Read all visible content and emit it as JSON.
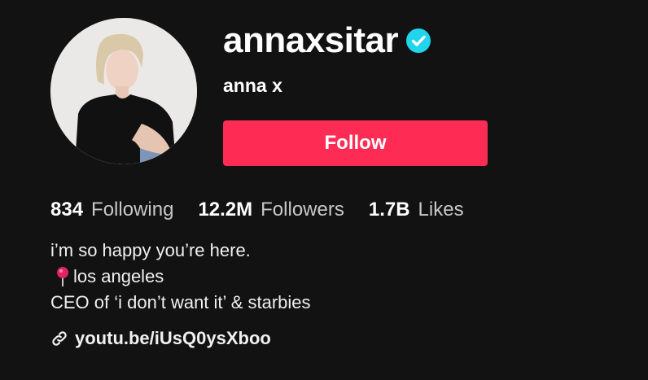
{
  "profile": {
    "username": "annaxsitar",
    "verified": true,
    "verified_color": "#20d5ec",
    "display_name": "anna x",
    "avatar_alt": "profile photo"
  },
  "follow_button": {
    "label": "Follow",
    "color": "#fe2c55"
  },
  "stats": [
    {
      "value": "834",
      "label": "Following"
    },
    {
      "value": "12.2M",
      "label": "Followers"
    },
    {
      "value": "1.7B",
      "label": "Likes"
    }
  ],
  "bio": {
    "line1": "i’m so happy you’re here.",
    "line2_icon": "pin-icon",
    "line2": "los angeles",
    "line3": "CEO of ‘i don’t want it’ & starbies"
  },
  "link": {
    "icon": "link-icon",
    "text": "youtu.be/iUsQ0ysXboo"
  }
}
